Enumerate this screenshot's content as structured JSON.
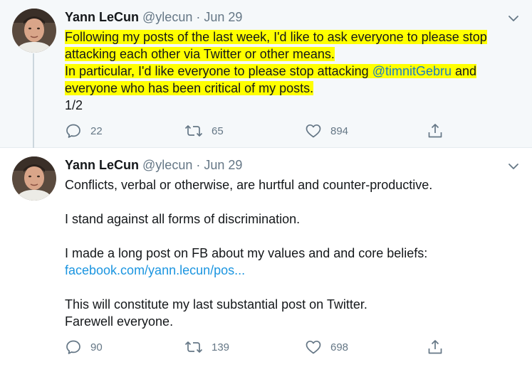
{
  "tweets": [
    {
      "author_name": "Yann LeCun",
      "author_handle": "@ylecun",
      "separator": "·",
      "date": "Jun 29",
      "avatar_icon": "user-avatar-photo",
      "lines": {
        "l1": "Following my posts of the last week, I'd like to ask everyone to please stop",
        "l2": "attacking each other via Twitter or other means.",
        "l3_prefix": "In particular, I'd like everyone to please stop attacking ",
        "l3_mention": "@timnitGebru",
        "l3_suffix": "  and",
        "l4": "everyone who has been critical of my posts.",
        "l5": "1/2"
      },
      "highlight_color": "#ffff00",
      "reply_count": "22",
      "retweet_count": "65",
      "like_count": "894"
    },
    {
      "author_name": "Yann LeCun",
      "author_handle": "@ylecun",
      "separator": "·",
      "date": "Jun 29",
      "avatar_icon": "user-avatar-photo",
      "lines": {
        "l1": "Conflicts, verbal or otherwise, are hurtful and counter-productive.",
        "l2": "I stand against all forms of discrimination.",
        "l3": "I made a long post on FB about my values and and core beliefs:",
        "l4_link": "facebook.com/yann.lecun/pos...",
        "l5": "This will constitute my last substantial post on Twitter.",
        "l6": "Farewell everyone."
      },
      "reply_count": "90",
      "retweet_count": "139",
      "like_count": "698"
    }
  ],
  "colors": {
    "text_primary": "#14171a",
    "text_secondary": "#657786",
    "link": "#1b95e0",
    "thread_line": "#ccd6dd",
    "focused_background": "#f5f8fa"
  },
  "icons": {
    "reply": "reply-icon",
    "retweet": "retweet-icon",
    "like": "heart-icon",
    "share": "share-icon",
    "menu": "chevron-down-icon"
  }
}
